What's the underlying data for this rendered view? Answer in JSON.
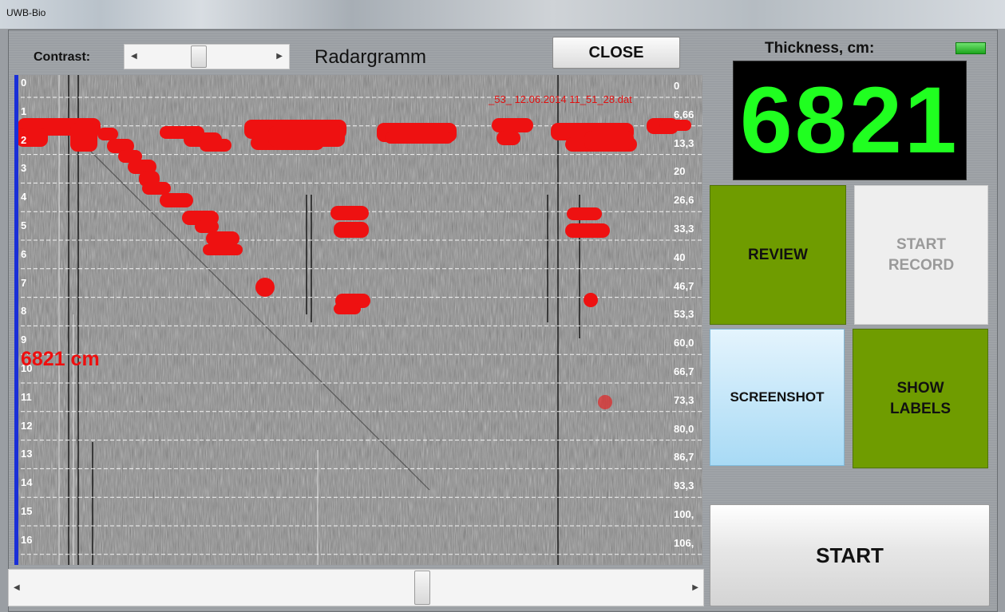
{
  "window": {
    "title": "UWB-Bio"
  },
  "toolbar": {
    "contrast_label": "Contrast:",
    "contrast_level": 0.43,
    "radar_title": "Radargramm",
    "close_label": "CLOSE"
  },
  "radar": {
    "file_name": "_53_ 12.06.2014 11_51_28.dat",
    "thickness_marker": "6821 cm",
    "depth_labels": [
      "0",
      "1",
      "2",
      "3",
      "4",
      "5",
      "6",
      "7",
      "8",
      "9",
      "10",
      "11",
      "12",
      "13",
      "14",
      "15",
      "16"
    ],
    "right_labels": [
      "0",
      "6,66",
      "13,3",
      "20",
      "26,6",
      "33,3",
      "40",
      "46,7",
      "53,3",
      "60,0",
      "66,7",
      "73,3",
      "80,0",
      "86,7",
      "93,3",
      "100,",
      "106,"
    ],
    "scroll_level": 0.6,
    "colors": {
      "marker": "#ee0e0e",
      "depth_bar": "#1a2fd8",
      "grid": "#ffffff"
    }
  },
  "panel": {
    "thickness_label": "Thickness, cm:",
    "thickness_value": "6821",
    "status_led_color": "#2fc52f",
    "review_label": "REVIEW",
    "start_record_label": "START\nRECORD",
    "screenshot_label": "SCREENSHOT",
    "show_labels_label": "SHOW\nLABELS",
    "start_label": "START",
    "colors": {
      "active_tile": "#6f9c00",
      "display_digits": "#20ff20",
      "screenshot_tile": "#a8daf5"
    }
  },
  "icons": {
    "scroll_left": "scroll-left-icon",
    "scroll_right": "scroll-right-icon",
    "status_led": "status-led-icon"
  }
}
